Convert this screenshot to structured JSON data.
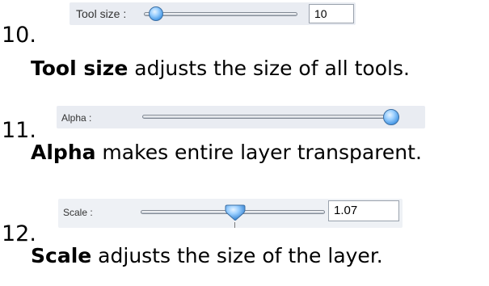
{
  "items": [
    {
      "number": "10.",
      "control": {
        "label": "Tool size :",
        "value": "10",
        "slider_fraction": 0.12
      },
      "bold": "Tool size",
      "rest": " adjusts the size of all tools."
    },
    {
      "number": "11.",
      "control": {
        "label": "Alpha :",
        "slider_fraction": 1.0
      },
      "bold": "Alpha",
      "rest": " makes entire layer transparent."
    },
    {
      "number": "12.",
      "control": {
        "label": "Scale :",
        "value": "1.07",
        "slider_fraction": 0.5
      },
      "bold": "Scale",
      "rest": " adjusts the size of the layer."
    }
  ],
  "colors": {
    "strip_bg": "#e9ecf2",
    "knob_blue": "#3a8fe0"
  },
  "icons": [
    "slider-knob-icon"
  ]
}
